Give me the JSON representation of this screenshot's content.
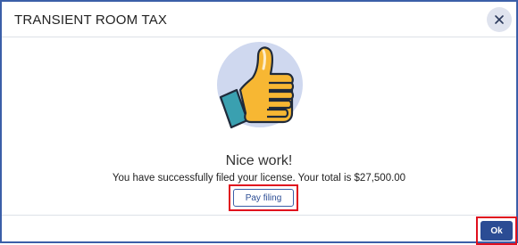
{
  "modal": {
    "title": "TRANSIENT ROOM TAX",
    "close_icon": "close-icon"
  },
  "content": {
    "illustration_icon": "thumbs-up-icon",
    "headline": "Nice work!",
    "message": "You have successfully filed your license. Your total is $27,500.00",
    "pay_button_label": "Pay filing"
  },
  "footer": {
    "ok_button_label": "Ok"
  },
  "colors": {
    "brand": "#2b4c94",
    "highlight": "#e0101e",
    "thumb_yellow": "#f7b733",
    "circle_bg": "#cfd8ef",
    "cuff": "#3aa0b0"
  }
}
